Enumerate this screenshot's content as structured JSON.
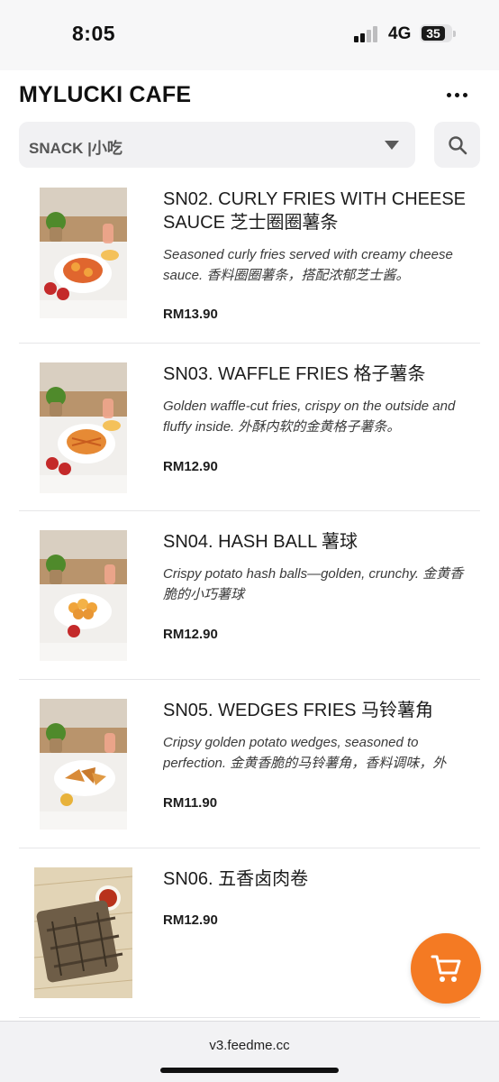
{
  "status_bar": {
    "time": "8:05",
    "network": "4G",
    "battery_level": "35"
  },
  "header": {
    "title": "MYLUCKI CAFE",
    "more_icon": "more-horizontal-icon"
  },
  "category_select": {
    "selected": "SNACK |小吃"
  },
  "search": {
    "icon": "search-icon"
  },
  "menu_items": [
    {
      "title": "SN02. CURLY FRIES WITH CHEESE SAUCE 芝士圈圈薯条",
      "description": "Seasoned curly fries served with creamy cheese sauce. 香料圈圈薯条，搭配浓郁芝士酱。",
      "price": "RM13.90"
    },
    {
      "title": "SN03. WAFFLE FRIES 格子薯条",
      "description": "Golden waffle-cut fries, crispy on the outside and fluffy inside. 外酥内软的金黄格子薯条。",
      "price": "RM12.90"
    },
    {
      "title": "SN04. HASH BALL 薯球",
      "description": "Crispy potato hash balls—golden, crunchy. 金黄香脆的小巧薯球",
      "price": "RM12.90"
    },
    {
      "title": "SN05. WEDGES FRIES 马铃薯角",
      "description": "Cripsy golden potato wedges, seasoned to perfection. 金黄香脆的马铃薯角，香料调味，外酥...",
      "price": "RM11.90"
    },
    {
      "title": "SN06. 五香卤肉卷",
      "description": "",
      "price": "RM12.90"
    }
  ],
  "cart": {
    "icon": "cart-icon",
    "color": "#f47a23"
  },
  "browser": {
    "url": "v3.feedme.cc"
  }
}
